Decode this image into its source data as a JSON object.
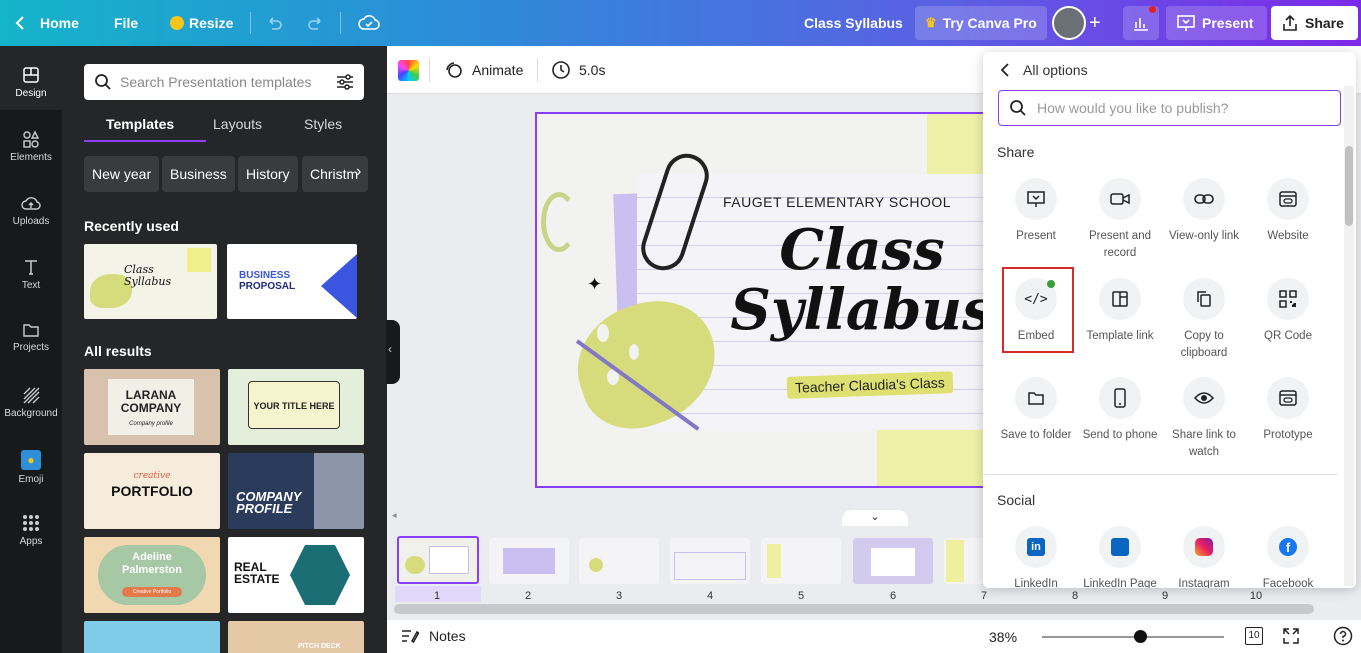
{
  "topbar": {
    "home": "Home",
    "file": "File",
    "resize": "Resize",
    "title": "Class Syllabus",
    "try_pro": "Try Canva Pro",
    "present": "Present",
    "share": "Share"
  },
  "rail": [
    {
      "label": "Design",
      "icon": "design-icon"
    },
    {
      "label": "Elements",
      "icon": "elements-icon"
    },
    {
      "label": "Uploads",
      "icon": "upload-icon"
    },
    {
      "label": "Text",
      "icon": "text-icon"
    },
    {
      "label": "Projects",
      "icon": "folder-icon"
    },
    {
      "label": "Background",
      "icon": "background-icon"
    },
    {
      "label": "Emoji",
      "icon": "emoji-icon"
    },
    {
      "label": "Apps",
      "icon": "apps-icon"
    }
  ],
  "panel": {
    "search_placeholder": "Search Presentation templates",
    "tabs": [
      "Templates",
      "Layouts",
      "Styles"
    ],
    "chips": [
      "New year",
      "Business",
      "History",
      "Christm"
    ],
    "recently_used": "Recently used",
    "all_results": "All results",
    "recent": [
      {
        "l1": "Class",
        "l2": "Syllabus"
      },
      {
        "l1": "BUSINESS",
        "l2": "PROPOSAL"
      }
    ],
    "results": [
      {
        "l1": "LARANA",
        "l2": "COMPANY",
        "sub": "Company profile"
      },
      {
        "l1": "YOUR TITLE HERE",
        "l2": "",
        "sub": ""
      },
      {
        "l1": "creative",
        "l2": "PORTFOLIO",
        "sub": ""
      },
      {
        "l1": "COMPANY",
        "l2": "PROFILE",
        "sub": ""
      },
      {
        "l1": "Adeline",
        "l2": "Palmerston",
        "sub": "Creative Portfolio"
      },
      {
        "l1": "REAL",
        "l2": "ESTATE",
        "sub": ""
      },
      {
        "l1": "",
        "l2": "",
        "sub": ""
      },
      {
        "l1": "PITCH DECK",
        "l2": "",
        "sub": ""
      }
    ]
  },
  "toolbar": {
    "animate": "Animate",
    "duration": "5.0s"
  },
  "slide": {
    "school": "FAUGET ELEMENTARY SCHOOL",
    "title_line1": "Class",
    "title_line2": "Syllabus",
    "teacher": "Teacher Claudia's Class"
  },
  "pages": [
    "1",
    "2",
    "3",
    "4",
    "5",
    "6",
    "7",
    "8",
    "9",
    "10"
  ],
  "bottom": {
    "notes": "Notes",
    "zoom": "38%",
    "page_count": "10",
    "zoom_fraction": 0.38
  },
  "publish": {
    "back": "All options",
    "search_placeholder": "How would you like to publish?",
    "share_heading": "Share",
    "social_heading": "Social",
    "share_options": [
      {
        "label": "Present",
        "icon": "present-icon"
      },
      {
        "label": "Present and record",
        "icon": "video-camera-icon"
      },
      {
        "label": "View-only link",
        "icon": "link-icon"
      },
      {
        "label": "Website",
        "icon": "website-icon"
      },
      {
        "label": "Embed",
        "icon": "embed-code-icon"
      },
      {
        "label": "Template link",
        "icon": "template-link-icon"
      },
      {
        "label": "Copy to clipboard",
        "icon": "copy-icon"
      },
      {
        "label": "QR Code",
        "icon": "qr-code-icon"
      },
      {
        "label": "Save to folder",
        "icon": "folder-icon"
      },
      {
        "label": "Send to phone",
        "icon": "phone-icon"
      },
      {
        "label": "Share link to watch",
        "icon": "eye-icon"
      },
      {
        "label": "Prototype",
        "icon": "prototype-icon"
      }
    ],
    "social_options": [
      {
        "label": "LinkedIn",
        "icon": "linkedin-icon"
      },
      {
        "label": "LinkedIn Page",
        "icon": "linkedin-page-icon"
      },
      {
        "label": "Instagram",
        "icon": "instagram-icon"
      },
      {
        "label": "Facebook",
        "icon": "facebook-icon"
      }
    ]
  },
  "colors": {
    "accent": "#8b3dff",
    "highlight": "#d92b2b",
    "brand_gradient_start": "#14b4c9",
    "brand_gradient_end": "#7d2ae8"
  }
}
